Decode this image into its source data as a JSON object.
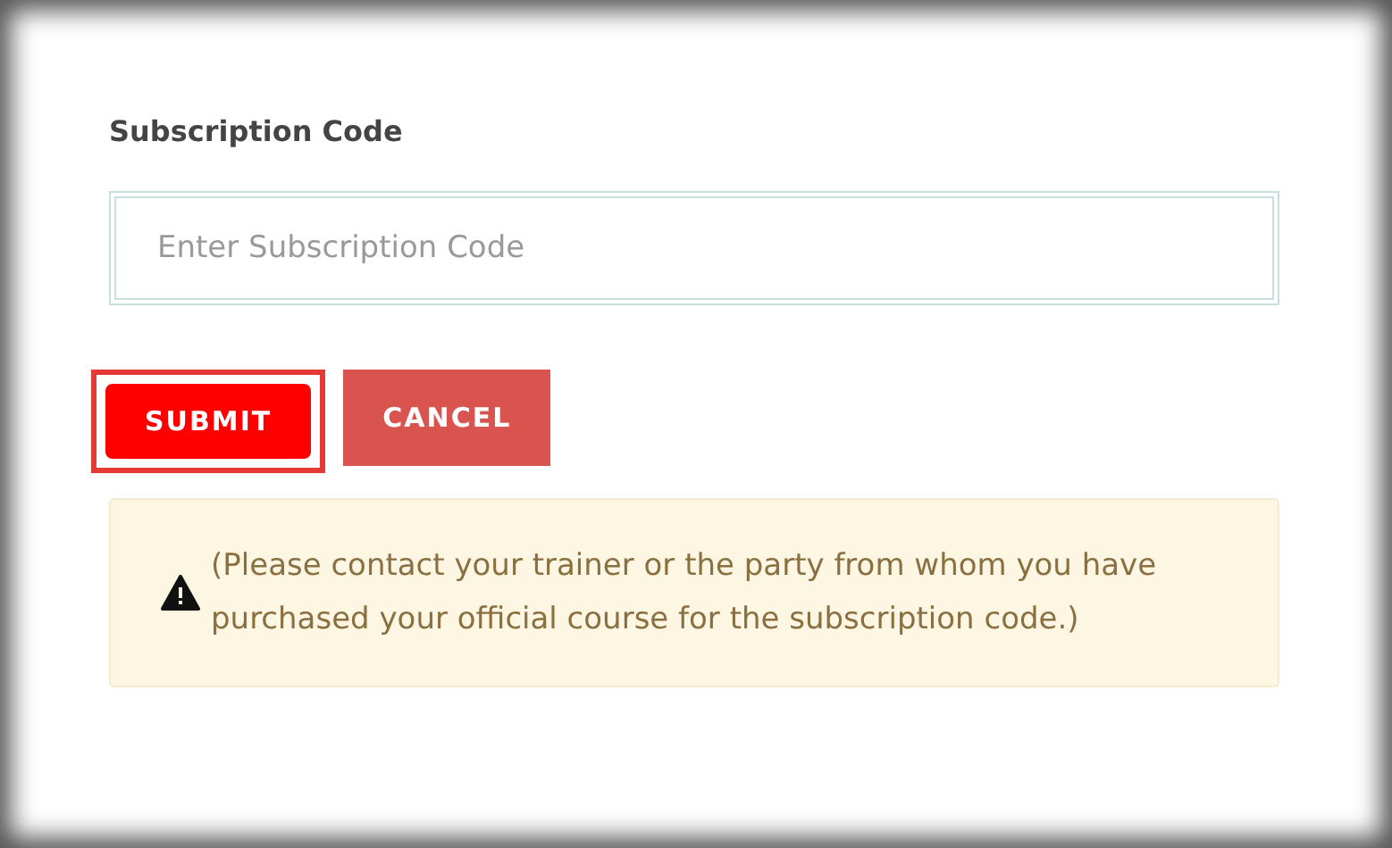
{
  "field": {
    "label": "Subscription Code",
    "placeholder": "Enter Subscription Code"
  },
  "buttons": [
    {
      "kind": "primary",
      "label": "SUBMIT",
      "focused": true
    },
    {
      "kind": "secondary",
      "label": "CANCEL",
      "focused": false
    }
  ],
  "notice": {
    "text": "(Please contact your trainer or the party from whom you have purchased your official course for the subscription code.)"
  }
}
